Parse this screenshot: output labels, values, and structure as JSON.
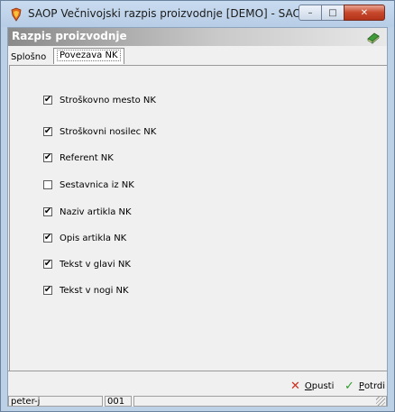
{
  "window": {
    "title": "SAOP Večnivojski razpis proizvodnje  [DEMO] - SAOP RAČUN...",
    "controls": {
      "minimize": "–",
      "maximize": "□",
      "close": "✕"
    }
  },
  "header": {
    "title": "Razpis proizvodnje"
  },
  "tabs": [
    {
      "label": "Splošno",
      "active": false
    },
    {
      "label": "Povezava NK",
      "active": true
    }
  ],
  "checkboxes": [
    {
      "label": "Stroškovno mesto NK",
      "checked": true
    },
    {
      "label": "Stroškovni nosilec NK",
      "checked": true
    },
    {
      "label": "Referent NK",
      "checked": true
    },
    {
      "label": "Sestavnica iz NK",
      "checked": false
    },
    {
      "label": "Naziv artikla NK",
      "checked": true
    },
    {
      "label": "Opis artikla NK",
      "checked": true
    },
    {
      "label": "Tekst v glavi NK",
      "checked": true
    },
    {
      "label": "Tekst v nogi NK",
      "checked": true
    }
  ],
  "buttons": {
    "cancel": {
      "accel": "O",
      "rest": "pusti",
      "icon": "✕"
    },
    "confirm": {
      "accel": "P",
      "rest": "otrdi",
      "icon": "✓"
    }
  },
  "status": {
    "user": "peter-j",
    "code": "001"
  },
  "colors": {
    "cancel_icon": "#d12c1c",
    "confirm_icon": "#2e9b2e"
  }
}
